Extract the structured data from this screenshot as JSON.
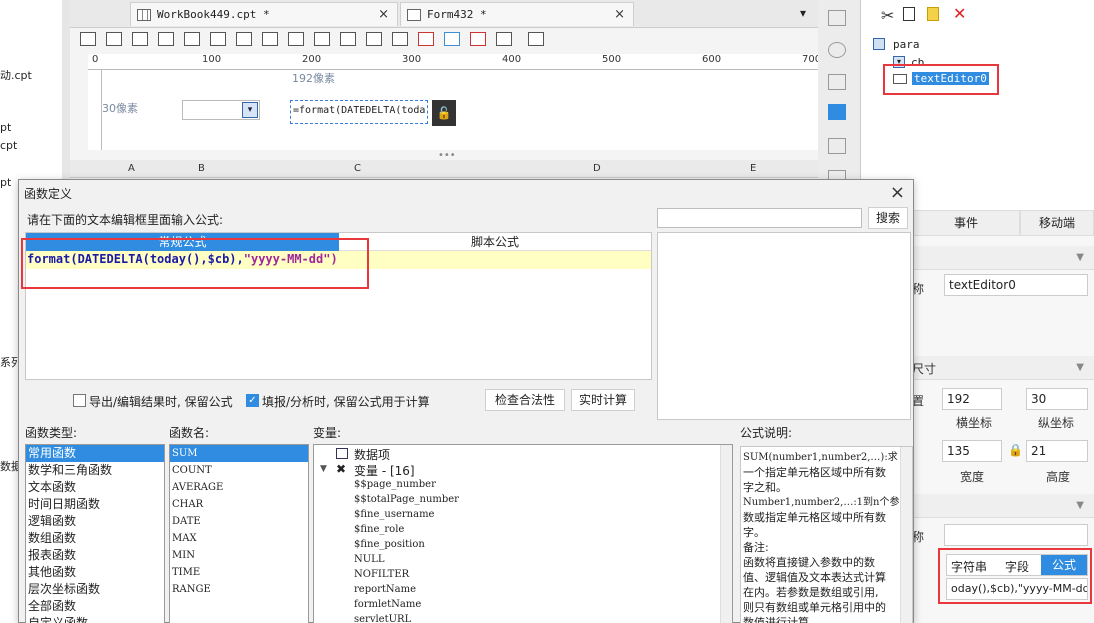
{
  "left_strip": {
    "items": [
      "动.cpt",
      "pt",
      "cpt",
      "pt",
      "系列",
      "数据"
    ]
  },
  "tabs": [
    {
      "label": "WorkBook449.cpt *",
      "close": "×"
    },
    {
      "label": "Form432 *",
      "close": "×"
    }
  ],
  "ruler": {
    "marks": [
      "0",
      "100",
      "200",
      "300",
      "400",
      "500",
      "600",
      "700"
    ]
  },
  "canvas": {
    "dim_label": "192像素",
    "height_label": "30像素",
    "formula_preview": "=format(DATEDELTA(toda"
  },
  "grid": {
    "columns": [
      "A",
      "B",
      "C",
      "D",
      "E"
    ]
  },
  "tree": {
    "root": "para",
    "children": [
      "cb",
      "textEditor0"
    ]
  },
  "props": {
    "tabs": [
      "事件",
      "移动端"
    ],
    "name_label": "称",
    "name_value": "textEditor0",
    "size_label": "尺寸",
    "x_value": "192",
    "y_value": "30",
    "x_label": "横坐标",
    "y_label": "纵坐标",
    "w_value": "135",
    "h_value": "21",
    "w_label": "宽度",
    "h_label": "高度",
    "name2_label": "称",
    "value_tabs": [
      "字符串",
      "字段",
      "公式"
    ],
    "value_text": "oday(),$cb),\"yyyy-MM-dd\")"
  },
  "dialog": {
    "title": "函数定义",
    "close": "×",
    "instruction": "请在下面的文本编辑框里面输入公式:",
    "tab_normal": "常规公式",
    "tab_script": "脚本公式",
    "formula_code": "format(DATEDELTA(today(),$cb),",
    "formula_string": "\"yyyy-MM-dd\")",
    "search_button": "搜索",
    "option_export": "导出/编辑结果时, 保留公式",
    "option_fill": "填报/分析时, 保留公式用于计算",
    "check_button": "检查合法性",
    "realtime_button": "实时计算",
    "func_type_header": "函数类型:",
    "func_name_header": "函数名:",
    "variable_header": "变量:",
    "explain_header": "公式说明:",
    "func_types": [
      "常用函数",
      "数学和三角函数",
      "文本函数",
      "时间日期函数",
      "逻辑函数",
      "数组函数",
      "报表函数",
      "其他函数",
      "层次坐标函数",
      "全部函数",
      "自定义函数"
    ],
    "func_names": [
      "SUM",
      "COUNT",
      "AVERAGE",
      "CHAR",
      "DATE",
      "MAX",
      "MIN",
      "TIME",
      "RANGE"
    ],
    "variables": {
      "data_item": "数据项",
      "var_group": "变量 - [16]",
      "items": [
        "$$page_number",
        "$$totalPage_number",
        "$fine_username",
        "$fine_role",
        "$fine_position",
        "NULL",
        "NOFILTER",
        "reportName",
        "formletName",
        "servletURL"
      ]
    },
    "explain_lines": [
      "SUM(number1,number2,…):求",
      "一个指定单元格区域中所有数",
      "字之和。",
      "Number1,number2,…:1到n个参",
      "数或指定单元格区域中所有数",
      "字。",
      "备注:",
      "函数将直接键入参数中的数",
      "值、逻辑值及文本表达式计算",
      "在内。若参数是数组或引用,",
      "则只有数组或单元格引用中的",
      "数值进行计算。"
    ]
  },
  "colors": {
    "accent": "#2f8ce0",
    "highlight_red": "#e8383d",
    "editor_line": "#ffffc4"
  }
}
